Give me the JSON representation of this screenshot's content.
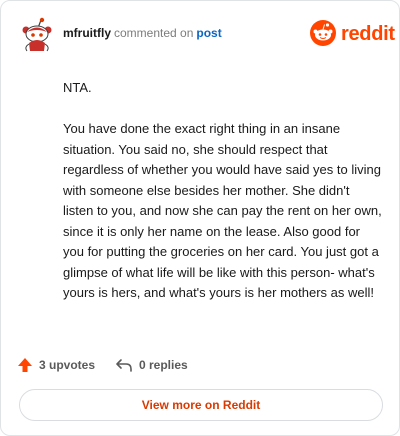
{
  "header": {
    "username": "mfruitfly",
    "action_text": "commented on",
    "post_link": "post",
    "brand_name": "reddit",
    "brand_color": "#ff4500"
  },
  "comment": {
    "paragraphs": [
      "NTA.",
      "You have done the exact right thing in an insane situation. You said no, she should respect that regardless of whether you would have said yes to living with someone else besides her mother. She didn't listen to you, and now she can pay the rent on her own, since it is only her name on the lease. Also good for you for putting the groceries on her card. You just got a glimpse of what life will be like with this person- what's yours is hers, and what's yours is her mothers as well!"
    ]
  },
  "actions": {
    "upvotes_label": "3 upvotes",
    "replies_label": "0 replies"
  },
  "footer": {
    "view_more_label": "View more on Reddit"
  },
  "icons": {
    "avatar": "snoo-avatar-icon",
    "brand": "reddit-logo-icon",
    "upvote": "upvote-arrow-icon",
    "reply": "reply-arrow-icon"
  }
}
